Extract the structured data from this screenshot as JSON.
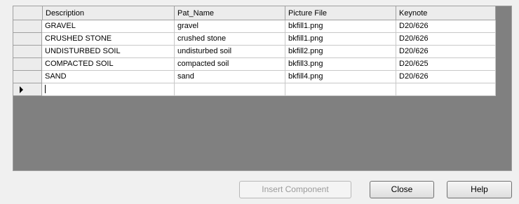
{
  "grid": {
    "columns": [
      "Description",
      "Pat_Name",
      "Picture File",
      "Keynote"
    ],
    "rows": [
      {
        "description": "GRAVEL",
        "pat_name": "gravel",
        "picture_file": "bkfill1.png",
        "keynote": "D20/626"
      },
      {
        "description": "CRUSHED STONE",
        "pat_name": "crushed stone",
        "picture_file": "bkfill1.png",
        "keynote": "D20/626"
      },
      {
        "description": "UNDISTURBED SOIL",
        "pat_name": "undisturbed soil",
        "picture_file": "bkfill2.png",
        "keynote": "D20/626"
      },
      {
        "description": "COMPACTED SOIL",
        "pat_name": "compacted soil",
        "picture_file": "bkfill3.png",
        "keynote": "D20/625"
      },
      {
        "description": "SAND",
        "pat_name": "sand",
        "picture_file": "bkfill4.png",
        "keynote": "D20/626"
      }
    ],
    "new_row": {
      "description": "",
      "pat_name": "",
      "picture_file": "",
      "keynote": ""
    }
  },
  "buttons": {
    "insert_component": "Insert Component",
    "close": "Close",
    "help": "Help"
  },
  "icons": {
    "current_row": "row-pointer-arrow-icon"
  },
  "colors": {
    "grid_background": "#808080",
    "cell_background": "#ffffff",
    "header_background": "#ececec"
  }
}
